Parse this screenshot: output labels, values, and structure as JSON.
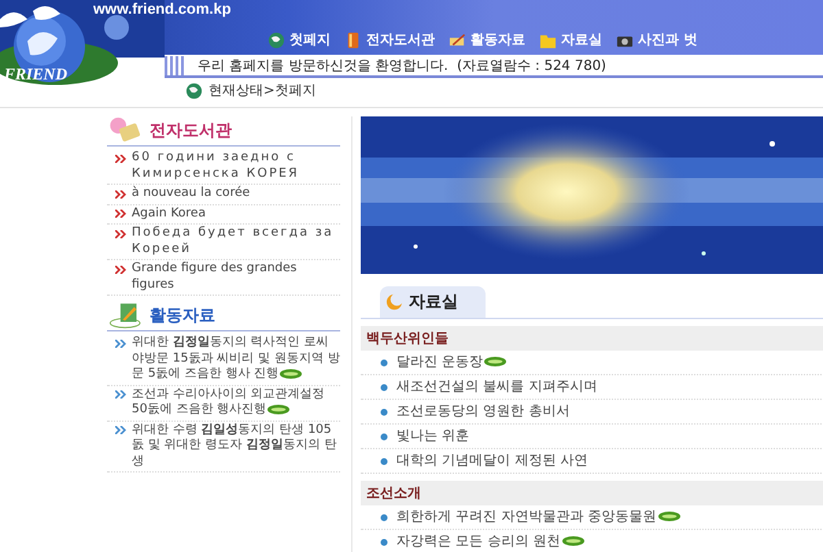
{
  "site": {
    "url": "www.friend.com.kp",
    "logo_text": "FRIEND"
  },
  "nav": [
    {
      "label": "첫페지"
    },
    {
      "label": "전자도서관"
    },
    {
      "label": "활동자료"
    },
    {
      "label": "자료실"
    },
    {
      "label": "사진과 벗"
    }
  ],
  "welcome": "우리 홈페지를 방문하신것을 환영합니다.  (자료열람수 : 524 780)",
  "breadcrumb": "현재상태>첫페지",
  "sidebar": [
    {
      "title": "전자도서관",
      "color": "#c0306a",
      "items": [
        {
          "text": "60 години заедно с Кимирсенска КОРЕЯ",
          "spaced": true
        },
        {
          "text": "à nouveau la corée",
          "spaced": false
        },
        {
          "text": "Again Korea",
          "spaced": false
        },
        {
          "text": "Победа будет всегда за Кореей",
          "spaced": true
        },
        {
          "text": "Grande figure des grandes figures",
          "spaced": false
        }
      ]
    },
    {
      "title": "활동자료",
      "color": "#2a5fc0",
      "items": [
        {
          "text": "위대한 **김정일**동지의 력사적인 로씨야방문 15돐과 씨비리 및 원동지역 방문 5돐에 즈음한 행사 진행",
          "spaced": false,
          "new": true
        },
        {
          "text": "조선과 수리아사이의 외교관계설정 50돐에 즈음한 행사진행",
          "spaced": false,
          "new": true
        },
        {
          "text": "위대한 수령 **김일성**동지의 탄생 105돐 및 위대한 령도자 **김정일**동지의 탄생",
          "spaced": false,
          "new": false
        }
      ]
    }
  ],
  "archive": {
    "title": "자료실",
    "groups": [
      {
        "name": "백두산위인들",
        "items": [
          {
            "text": "달라진 운동장",
            "new": true
          },
          {
            "text": "새조선건설의 불씨를 지펴주시며",
            "new": false
          },
          {
            "text": "조선로동당의 영원한 총비서",
            "new": false
          },
          {
            "text": "빛나는 위훈",
            "new": false
          },
          {
            "text": "대학의 기념메달이 제정된 사연",
            "new": false
          }
        ]
      },
      {
        "name": "조선소개",
        "items": [
          {
            "text": "희한하게 꾸려진 자연박물관과 중앙동물원",
            "new": true
          },
          {
            "text": "자강력은 모든 승리의 원천",
            "new": true
          }
        ]
      }
    ]
  }
}
